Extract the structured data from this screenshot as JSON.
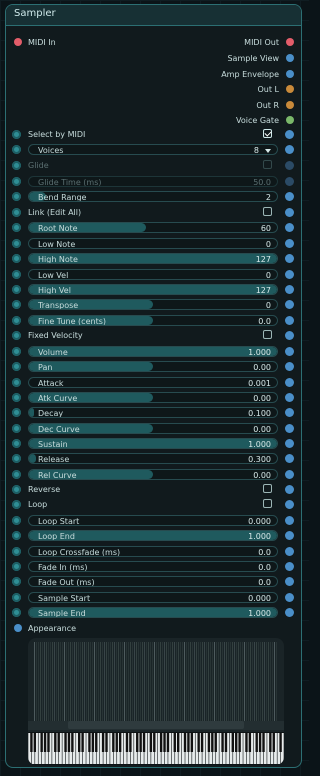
{
  "title": "Sampler",
  "ports": {
    "midi_in": "MIDI In",
    "outputs": [
      {
        "label": "MIDI Out",
        "color": "#e35d6a"
      },
      {
        "label": "Sample View",
        "color": "#4a8fc9"
      },
      {
        "label": "Amp Envelope",
        "color": "#4a8fc9"
      },
      {
        "label": "Out L",
        "color": "#c98a3a"
      },
      {
        "label": "Out R",
        "color": "#c98a3a"
      },
      {
        "label": "Voice Gate",
        "color": "#7ab86a"
      }
    ]
  },
  "params": {
    "select_by_midi": {
      "label": "Select by MIDI",
      "checked": true
    },
    "voices": {
      "label": "Voices",
      "value": "8"
    },
    "glide": {
      "label": "Glide",
      "checked": false
    },
    "glide_time": {
      "label": "Glide Time (ms)",
      "value": "50.0"
    },
    "bend_range": {
      "label": "Bend Range",
      "value": "2"
    },
    "link": {
      "label": "Link (Edit All)",
      "checked": false
    },
    "root_note": {
      "label": "Root Note",
      "value": "60",
      "fraction": 0.47
    },
    "low_note": {
      "label": "Low Note",
      "value": "0",
      "fraction": 0
    },
    "high_note": {
      "label": "High Note",
      "value": "127",
      "fraction": 1
    },
    "low_vel": {
      "label": "Low Vel",
      "value": "0",
      "fraction": 0
    },
    "high_vel": {
      "label": "High Vel",
      "value": "127",
      "fraction": 1
    },
    "transpose": {
      "label": "Transpose",
      "value": "0",
      "fraction": 0.5
    },
    "fine_tune": {
      "label": "Fine Tune (cents)",
      "value": "0.0",
      "fraction": 0.5
    },
    "fixed_velocity": {
      "label": "Fixed Velocity",
      "checked": false
    },
    "volume": {
      "label": "Volume",
      "value": "1.000",
      "fraction": 1
    },
    "pan": {
      "label": "Pan",
      "value": "0.00",
      "fraction": 0.5
    },
    "attack": {
      "label": "Attack",
      "value": "0.001",
      "fraction": 0
    },
    "atk_curve": {
      "label": "Atk Curve",
      "value": "0.00",
      "fraction": 0.5
    },
    "decay": {
      "label": "Decay",
      "value": "0.100",
      "fraction": 0.02
    },
    "dec_curve": {
      "label": "Dec Curve",
      "value": "0.00",
      "fraction": 0.5
    },
    "sustain": {
      "label": "Sustain",
      "value": "1.000",
      "fraction": 1
    },
    "release": {
      "label": "Release",
      "value": "0.300",
      "fraction": 0.03
    },
    "rel_curve": {
      "label": "Rel Curve",
      "value": "0.00",
      "fraction": 0.5
    },
    "reverse": {
      "label": "Reverse",
      "checked": false
    },
    "loop": {
      "label": "Loop",
      "checked": false
    },
    "loop_start": {
      "label": "Loop Start",
      "value": "0.000",
      "fraction": 0
    },
    "loop_end": {
      "label": "Loop End",
      "value": "1.000",
      "fraction": 1
    },
    "loop_crossfade": {
      "label": "Loop Crossfade (ms)",
      "value": "0.0",
      "fraction": 0
    },
    "fade_in": {
      "label": "Fade In (ms)",
      "value": "0.0",
      "fraction": 0
    },
    "fade_out": {
      "label": "Fade Out (ms)",
      "value": "0.0",
      "fraction": 0
    },
    "sample_start": {
      "label": "Sample Start",
      "value": "0.000",
      "fraction": 0
    },
    "sample_end": {
      "label": "Sample End",
      "value": "1.000",
      "fraction": 1
    }
  },
  "appearance": "Appearance",
  "colors": {
    "accent": "#2c6f73",
    "slider_fill": "#1f5a5e",
    "pin": "#4a8fc9"
  }
}
